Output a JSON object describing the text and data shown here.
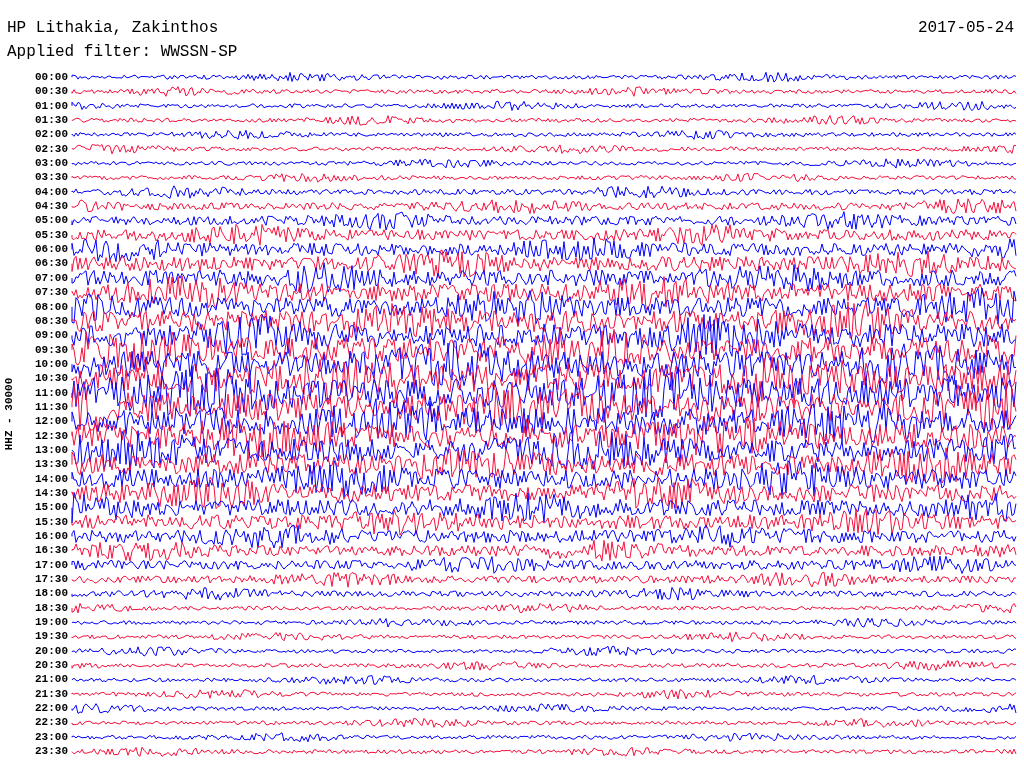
{
  "header": {
    "station": "HP Lithakia, Zakinthos",
    "date": "2017-05-24",
    "filter": "Applied filter: WWSSN-SP"
  },
  "channel_label": "HHZ - 30000",
  "rows": [
    {
      "time": "00:00",
      "color": "#0000ff"
    },
    {
      "time": "00:30",
      "color": "#f5103c"
    },
    {
      "time": "01:00",
      "color": "#0000ff"
    },
    {
      "time": "01:30",
      "color": "#f5103c"
    },
    {
      "time": "02:00",
      "color": "#0000ff"
    },
    {
      "time": "02:30",
      "color": "#f5103c"
    },
    {
      "time": "03:00",
      "color": "#0000ff"
    },
    {
      "time": "03:30",
      "color": "#f5103c"
    },
    {
      "time": "04:00",
      "color": "#0000ff"
    },
    {
      "time": "04:30",
      "color": "#f5103c"
    },
    {
      "time": "05:00",
      "color": "#0000ff"
    },
    {
      "time": "05:30",
      "color": "#f5103c"
    },
    {
      "time": "06:00",
      "color": "#0000ff"
    },
    {
      "time": "06:30",
      "color": "#f5103c"
    },
    {
      "time": "07:00",
      "color": "#0000ff"
    },
    {
      "time": "07:30",
      "color": "#f5103c"
    },
    {
      "time": "08:00",
      "color": "#0000ff"
    },
    {
      "time": "08:30",
      "color": "#f5103c"
    },
    {
      "time": "09:00",
      "color": "#0000ff"
    },
    {
      "time": "09:30",
      "color": "#f5103c"
    },
    {
      "time": "10:00",
      "color": "#0000ff"
    },
    {
      "time": "10:30",
      "color": "#f5103c"
    },
    {
      "time": "11:00",
      "color": "#0000ff"
    },
    {
      "time": "11:30",
      "color": "#f5103c"
    },
    {
      "time": "12:00",
      "color": "#0000ff"
    },
    {
      "time": "12:30",
      "color": "#f5103c"
    },
    {
      "time": "13:00",
      "color": "#0000ff"
    },
    {
      "time": "13:30",
      "color": "#f5103c"
    },
    {
      "time": "14:00",
      "color": "#0000ff"
    },
    {
      "time": "14:30",
      "color": "#f5103c"
    },
    {
      "time": "15:00",
      "color": "#0000ff"
    },
    {
      "time": "15:30",
      "color": "#f5103c"
    },
    {
      "time": "16:00",
      "color": "#0000ff"
    },
    {
      "time": "16:30",
      "color": "#f5103c"
    },
    {
      "time": "17:00",
      "color": "#0000ff"
    },
    {
      "time": "17:30",
      "color": "#f5103c"
    },
    {
      "time": "18:00",
      "color": "#0000ff"
    },
    {
      "time": "18:30",
      "color": "#f5103c"
    },
    {
      "time": "19:00",
      "color": "#0000ff"
    },
    {
      "time": "19:30",
      "color": "#f5103c"
    },
    {
      "time": "20:00",
      "color": "#0000ff"
    },
    {
      "time": "20:30",
      "color": "#f5103c"
    },
    {
      "time": "21:00",
      "color": "#0000ff"
    },
    {
      "time": "21:30",
      "color": "#f5103c"
    },
    {
      "time": "22:00",
      "color": "#0000ff"
    },
    {
      "time": "22:30",
      "color": "#f5103c"
    },
    {
      "time": "23:00",
      "color": "#0000ff"
    },
    {
      "time": "23:30",
      "color": "#f5103c"
    }
  ]
}
